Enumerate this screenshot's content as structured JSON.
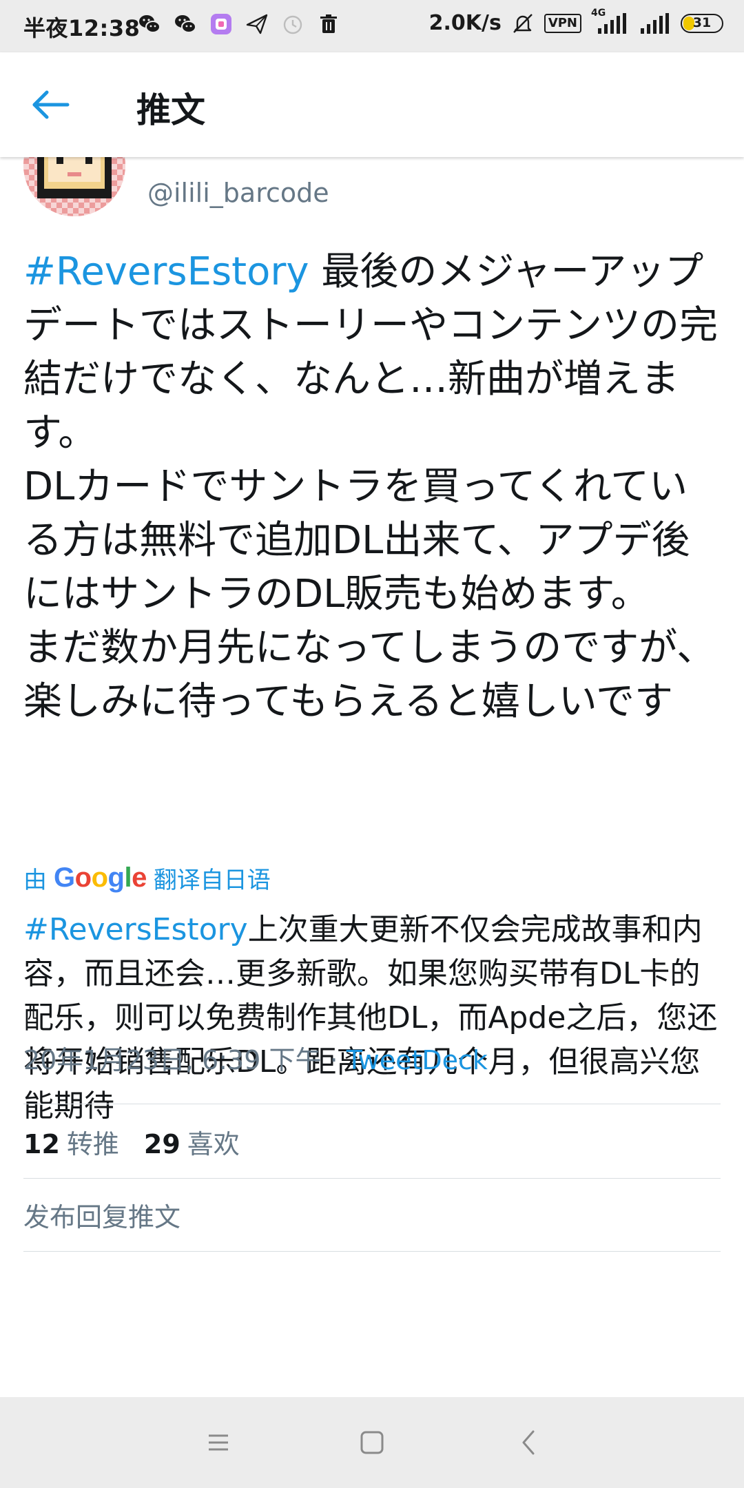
{
  "status_bar": {
    "time": "半夜12:38",
    "net_speed": "2.0K/s",
    "vpn_label": "VPN",
    "network_label": "4G",
    "battery_level": "31",
    "battery_fraction": 0.31,
    "left_icons": [
      "wechat-icon",
      "wechat-icon",
      "app-icon",
      "paper-plane-icon",
      "timer-icon",
      "trash-icon"
    ],
    "right_icons": [
      "mute-icon",
      "vpn-icon",
      "signal-icon",
      "signal-icon",
      "battery-icon"
    ]
  },
  "header": {
    "back_icon": "arrow-left-icon",
    "title": "推文"
  },
  "tweet": {
    "handle": "@ilili_barcode",
    "hashtag": "#ReversEstory",
    "body_after_hashtag": " 最後のメジャーアップデートではストーリーやコンテンツの完結だけでなく、なんと…新曲が増えます。",
    "body_lines": [
      "DLカードでサントラを買ってくれている方は無料で追加DL出来て、アプデ後にはサントラのDL販売も始めます。",
      "まだ数か月先になってしまうのですが、楽しみに待ってもらえると嬉しいです"
    ],
    "translate_prefix": "由",
    "translate_brand": "Google",
    "translate_suffix": "翻译自日语",
    "translated_hashtag": "#ReversEstory",
    "translated_text": "上次重大更新不仅会完成故事和内容，而且还会…更多新歌。如果您购买带有DL卡的配乐，则可以免费制作其他DL，而Apde之后，您还将开始销售配乐DL。距离还有几个月，但很高兴您能期待",
    "timestamp": "20年1月23日, 6:39 下午 · ",
    "source": "TweetDeck",
    "retweet_count": "12",
    "retweet_label": "转推",
    "like_count": "29",
    "like_label": "喜欢",
    "reply_placeholder": "发布回复推文"
  },
  "nav_bar": {
    "icons": [
      "menu-icon",
      "home-square-icon",
      "back-chevron-icon"
    ]
  },
  "colors": {
    "accent": "#1b95e0",
    "text_primary": "#14171a",
    "text_secondary": "#657786",
    "system_bar": "#ececec",
    "battery_fill": "#f0c800"
  }
}
